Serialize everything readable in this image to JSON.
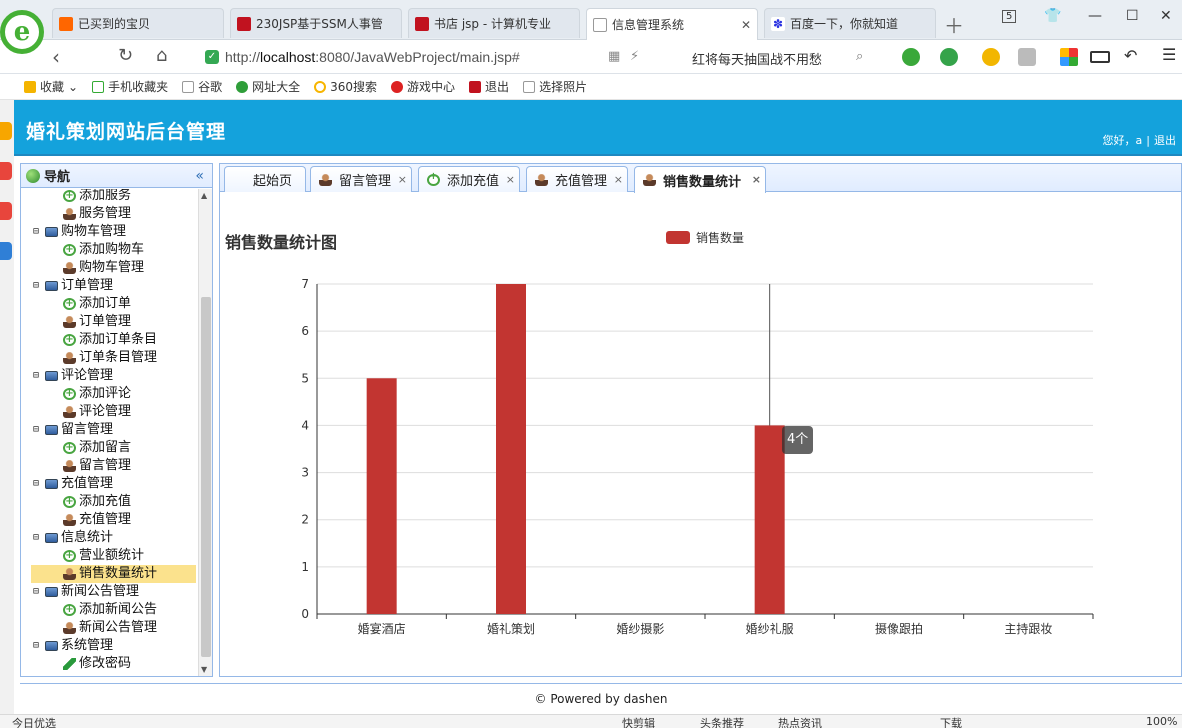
{
  "browser": {
    "tabs": [
      {
        "label": "已买到的宝贝",
        "icon": "taobao-icon"
      },
      {
        "label": "230JSP基于SSM人事管",
        "icon": "red-square-icon"
      },
      {
        "label": "书店 jsp - 计算机专业",
        "icon": "red-square-icon"
      },
      {
        "label": "信息管理系统",
        "icon": "page-icon"
      },
      {
        "label": "百度一下，你就知道",
        "icon": "baidu-paw-icon"
      }
    ],
    "url_prefix": "http://",
    "url_host": "localhost",
    "url_rest": ":8080/JavaWebProject/main.jsp#",
    "search_hint": "红将每天抽国战不用愁",
    "window_tab_count": "5",
    "bookmarks": [
      "收藏",
      "手机收藏夹",
      "谷歌",
      "网址大全",
      "360搜索",
      "游戏中心",
      "退出",
      "选择照片"
    ]
  },
  "app": {
    "title": "婚礼策划网站后台管理",
    "greeting": "您好，a",
    "logout": "退出",
    "nav_title": "导航",
    "tree": [
      {
        "level": 2,
        "icon": "add",
        "label": "添加服务"
      },
      {
        "level": 2,
        "icon": "person",
        "label": "服务管理"
      },
      {
        "level": 1,
        "icon": "monitor",
        "label": "购物车管理"
      },
      {
        "level": 2,
        "icon": "add",
        "label": "添加购物车"
      },
      {
        "level": 2,
        "icon": "person",
        "label": "购物车管理"
      },
      {
        "level": 1,
        "icon": "monitor",
        "label": "订单管理"
      },
      {
        "level": 2,
        "icon": "add",
        "label": "添加订单"
      },
      {
        "level": 2,
        "icon": "person",
        "label": "订单管理"
      },
      {
        "level": 2,
        "icon": "add",
        "label": "添加订单条目"
      },
      {
        "level": 2,
        "icon": "person",
        "label": "订单条目管理"
      },
      {
        "level": 1,
        "icon": "monitor",
        "label": "评论管理"
      },
      {
        "level": 2,
        "icon": "add",
        "label": "添加评论"
      },
      {
        "level": 2,
        "icon": "person",
        "label": "评论管理"
      },
      {
        "level": 1,
        "icon": "monitor",
        "label": "留言管理"
      },
      {
        "level": 2,
        "icon": "add",
        "label": "添加留言"
      },
      {
        "level": 2,
        "icon": "person",
        "label": "留言管理"
      },
      {
        "level": 1,
        "icon": "monitor",
        "label": "充值管理"
      },
      {
        "level": 2,
        "icon": "add",
        "label": "添加充值"
      },
      {
        "level": 2,
        "icon": "person",
        "label": "充值管理"
      },
      {
        "level": 1,
        "icon": "monitor",
        "label": "信息统计"
      },
      {
        "level": 2,
        "icon": "add",
        "label": "营业额统计"
      },
      {
        "level": 2,
        "icon": "person",
        "label": "销售数量统计",
        "selected": true
      },
      {
        "level": 1,
        "icon": "monitor",
        "label": "新闻公告管理"
      },
      {
        "level": 2,
        "icon": "add",
        "label": "添加新闻公告"
      },
      {
        "level": 2,
        "icon": "person",
        "label": "新闻公告管理"
      },
      {
        "level": 1,
        "icon": "monitor",
        "label": "系统管理"
      },
      {
        "level": 2,
        "icon": "pencil",
        "label": "修改密码"
      }
    ],
    "tabs": [
      {
        "label": "起始页",
        "icon": "",
        "closable": false
      },
      {
        "label": "留言管理",
        "icon": "person",
        "closable": true
      },
      {
        "label": "添加充值",
        "icon": "add",
        "closable": true
      },
      {
        "label": "充值管理",
        "icon": "person",
        "closable": true
      },
      {
        "label": "销售数量统计",
        "icon": "person",
        "closable": true,
        "active": true
      }
    ],
    "tooltip": "4个",
    "footer": "© Powered by dashen"
  },
  "status": {
    "left": "今日优选",
    "items": [
      "快剪辑",
      "头条推荐",
      "热点资讯",
      "下载"
    ],
    "zoom": "100%"
  },
  "colors": {
    "bar": "#c23531",
    "header": "#14a2dc",
    "selected": "#fbe28d"
  },
  "chart_data": {
    "type": "bar",
    "title": "销售数量统计图",
    "categories": [
      "婚宴酒店",
      "婚礼策划",
      "婚纱摄影",
      "婚纱礼服",
      "摄像跟拍",
      "主持跟妆"
    ],
    "series": [
      {
        "name": "销售数量",
        "values": [
          5,
          7,
          0,
          4,
          0,
          0
        ]
      }
    ],
    "ylim": [
      0,
      7
    ],
    "yticks": [
      0,
      1,
      2,
      3,
      4,
      5,
      6,
      7
    ],
    "grid": true,
    "legend": "top-center"
  }
}
